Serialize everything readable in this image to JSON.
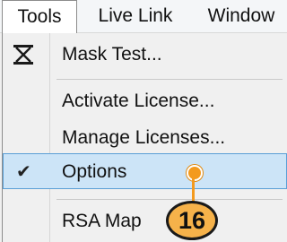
{
  "menubar": {
    "items": [
      {
        "label": "Tools"
      },
      {
        "label": "Live Link"
      },
      {
        "label": "Window"
      }
    ]
  },
  "dropdown": {
    "items": [
      {
        "label": "Mask Test...",
        "icon": "mask-test-icon"
      },
      {
        "label": "Activate License..."
      },
      {
        "label": "Manage Licenses..."
      },
      {
        "label": "Options",
        "checked": true
      },
      {
        "label": "RSA Map"
      }
    ]
  },
  "callout": {
    "number": "16",
    "color": "#f39a1e"
  },
  "colors": {
    "highlight_bg": "#cce4f7",
    "highlight_border": "#5a9fd6"
  }
}
